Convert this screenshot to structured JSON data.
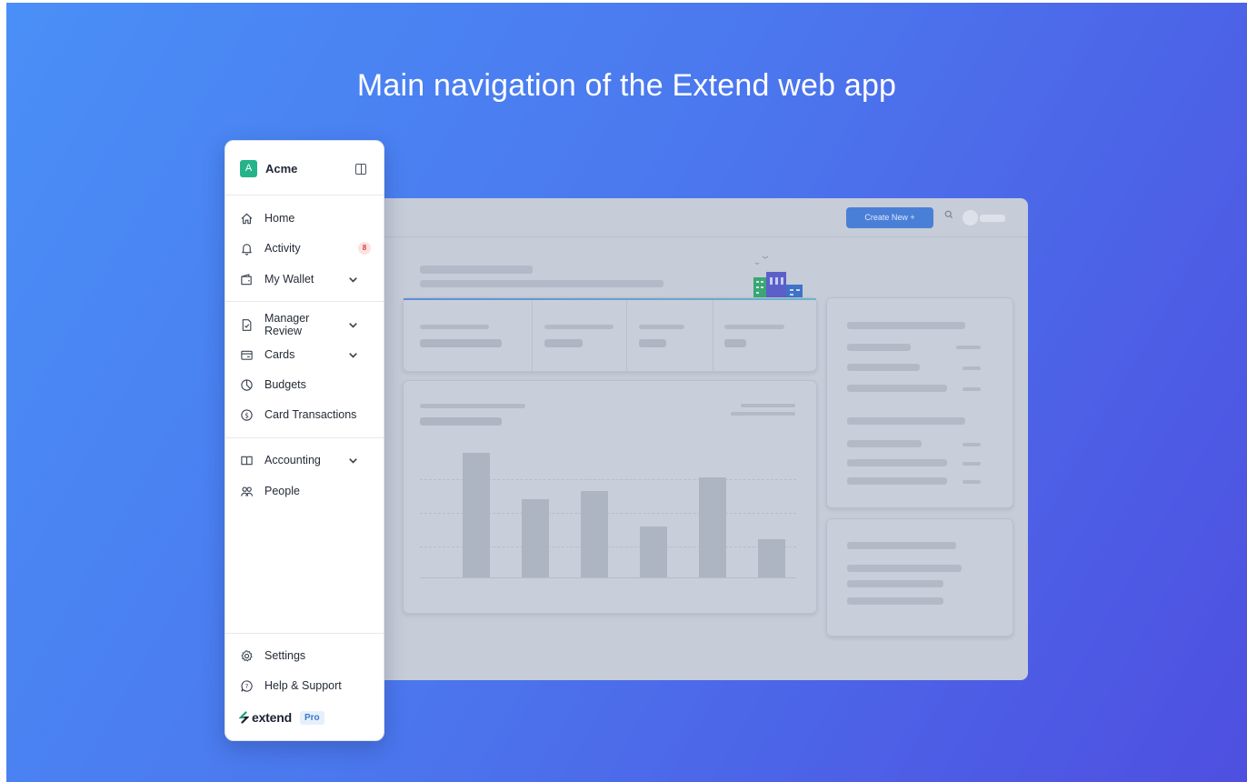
{
  "headline": "Main navigation of the Extend web app",
  "mock": {
    "create_label": "Create New  +",
    "chart_bar_fractions": [
      1.0,
      0.63,
      0.69,
      0.41,
      0.8,
      0.31
    ]
  },
  "sidebar": {
    "org_initial": "A",
    "org_name": "Acme",
    "items": [
      {
        "label": "Home",
        "icon": "home-icon"
      },
      {
        "label": "Activity",
        "icon": "bell-icon",
        "badge": "8"
      },
      {
        "label": "My Wallet",
        "icon": "wallet-icon",
        "expandable": true
      },
      {
        "label": "Manager Review",
        "icon": "review-icon",
        "expandable": true
      },
      {
        "label": "Cards",
        "icon": "card-icon",
        "expandable": true
      },
      {
        "label": "Budgets",
        "icon": "pie-icon"
      },
      {
        "label": "Card Transactions",
        "icon": "dollar-icon"
      },
      {
        "label": "Accounting",
        "icon": "book-icon",
        "expandable": true
      },
      {
        "label": "People",
        "icon": "people-icon"
      }
    ],
    "footer": [
      {
        "label": "Settings",
        "icon": "gear-icon"
      },
      {
        "label": "Help & Support",
        "icon": "help-icon"
      }
    ],
    "brand": {
      "name": "extend",
      "tier": "Pro"
    }
  },
  "colors": {
    "org_avatar": "#26b38a",
    "badge_text": "#e03a3a",
    "create_button": "#4a7fd8"
  }
}
